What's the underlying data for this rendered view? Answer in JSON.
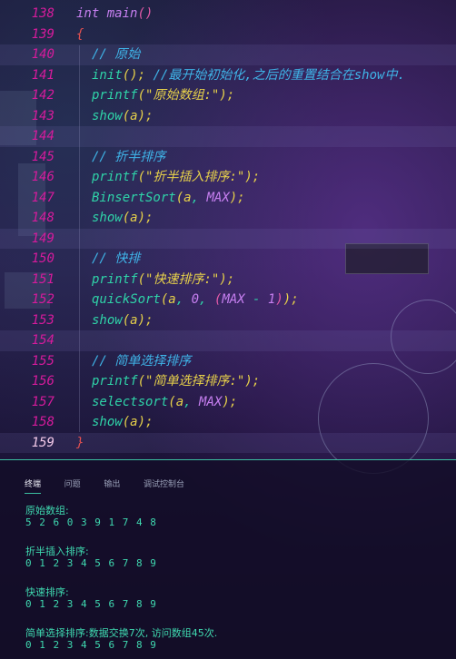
{
  "editor": {
    "lines": [
      {
        "n": "138"
      },
      {
        "n": "139"
      },
      {
        "n": "140"
      },
      {
        "n": "141"
      },
      {
        "n": "142"
      },
      {
        "n": "143"
      },
      {
        "n": "144"
      },
      {
        "n": "145"
      },
      {
        "n": "146"
      },
      {
        "n": "147"
      },
      {
        "n": "148"
      },
      {
        "n": "149"
      },
      {
        "n": "150"
      },
      {
        "n": "151"
      },
      {
        "n": "152"
      },
      {
        "n": "153"
      },
      {
        "n": "154"
      },
      {
        "n": "155"
      },
      {
        "n": "156"
      },
      {
        "n": "157"
      },
      {
        "n": "158"
      },
      {
        "n": "159"
      }
    ],
    "code": {
      "l138": {
        "type": "int",
        "name": "main",
        "parens": "()"
      },
      "l139": {
        "text": "{"
      },
      "l140": {
        "text": "// 原始"
      },
      "l141": {
        "call": "init",
        "rest": "();",
        "comment": " //最开始初始化,之后的重置结合在show中."
      },
      "l142": {
        "call": "printf",
        "arg": "\"原始数组:\""
      },
      "l143": {
        "call": "show",
        "arg": "a"
      },
      "l145": {
        "text": "// 折半排序"
      },
      "l146": {
        "call": "printf",
        "arg": "\"折半插入排序:\""
      },
      "l147": {
        "call": "BinsertSort",
        "arg1": "a",
        "arg2": "MAX"
      },
      "l148": {
        "call": "show",
        "arg": "a"
      },
      "l150": {
        "text": "// 快排"
      },
      "l151": {
        "call": "printf",
        "arg": "\"快速排序:\""
      },
      "l152": {
        "call": "quickSort",
        "arg1": "a",
        "arg2": "0",
        "arg3a": "MAX",
        "op": " - ",
        "arg3b": "1"
      },
      "l153": {
        "call": "show",
        "arg": "a"
      },
      "l155": {
        "text": "// 简单选择排序"
      },
      "l156": {
        "call": "printf",
        "arg": "\"简单选择排序:\""
      },
      "l157": {
        "call": "selectsort",
        "arg1": "a",
        "arg2": "MAX"
      },
      "l158": {
        "call": "show",
        "arg": "a"
      },
      "l159": {
        "text": "}"
      }
    }
  },
  "panel": {
    "tabs": [
      "终端",
      "问题",
      "输出",
      "调试控制台"
    ],
    "output": [
      "原始数组:",
      "5 2 6 0 3 9 1 7 4 8",
      "折半插入排序:",
      "0 1 2 3 4 5 6 7 8 9",
      "快速排序:",
      "0 1 2 3 4 5 6 7 8 9",
      "简单选择排序:数据交换7次, 访问数组45次.",
      "0 1 2 3 4 5 6 7 8 9"
    ]
  },
  "colors": {
    "line_number": "#d61b9c",
    "function": "#2fd3a8",
    "keyword": "#c67ff0",
    "string": "#e7d14a",
    "comment": "#3fb4e8",
    "terminal_text": "#3fd9b0"
  }
}
